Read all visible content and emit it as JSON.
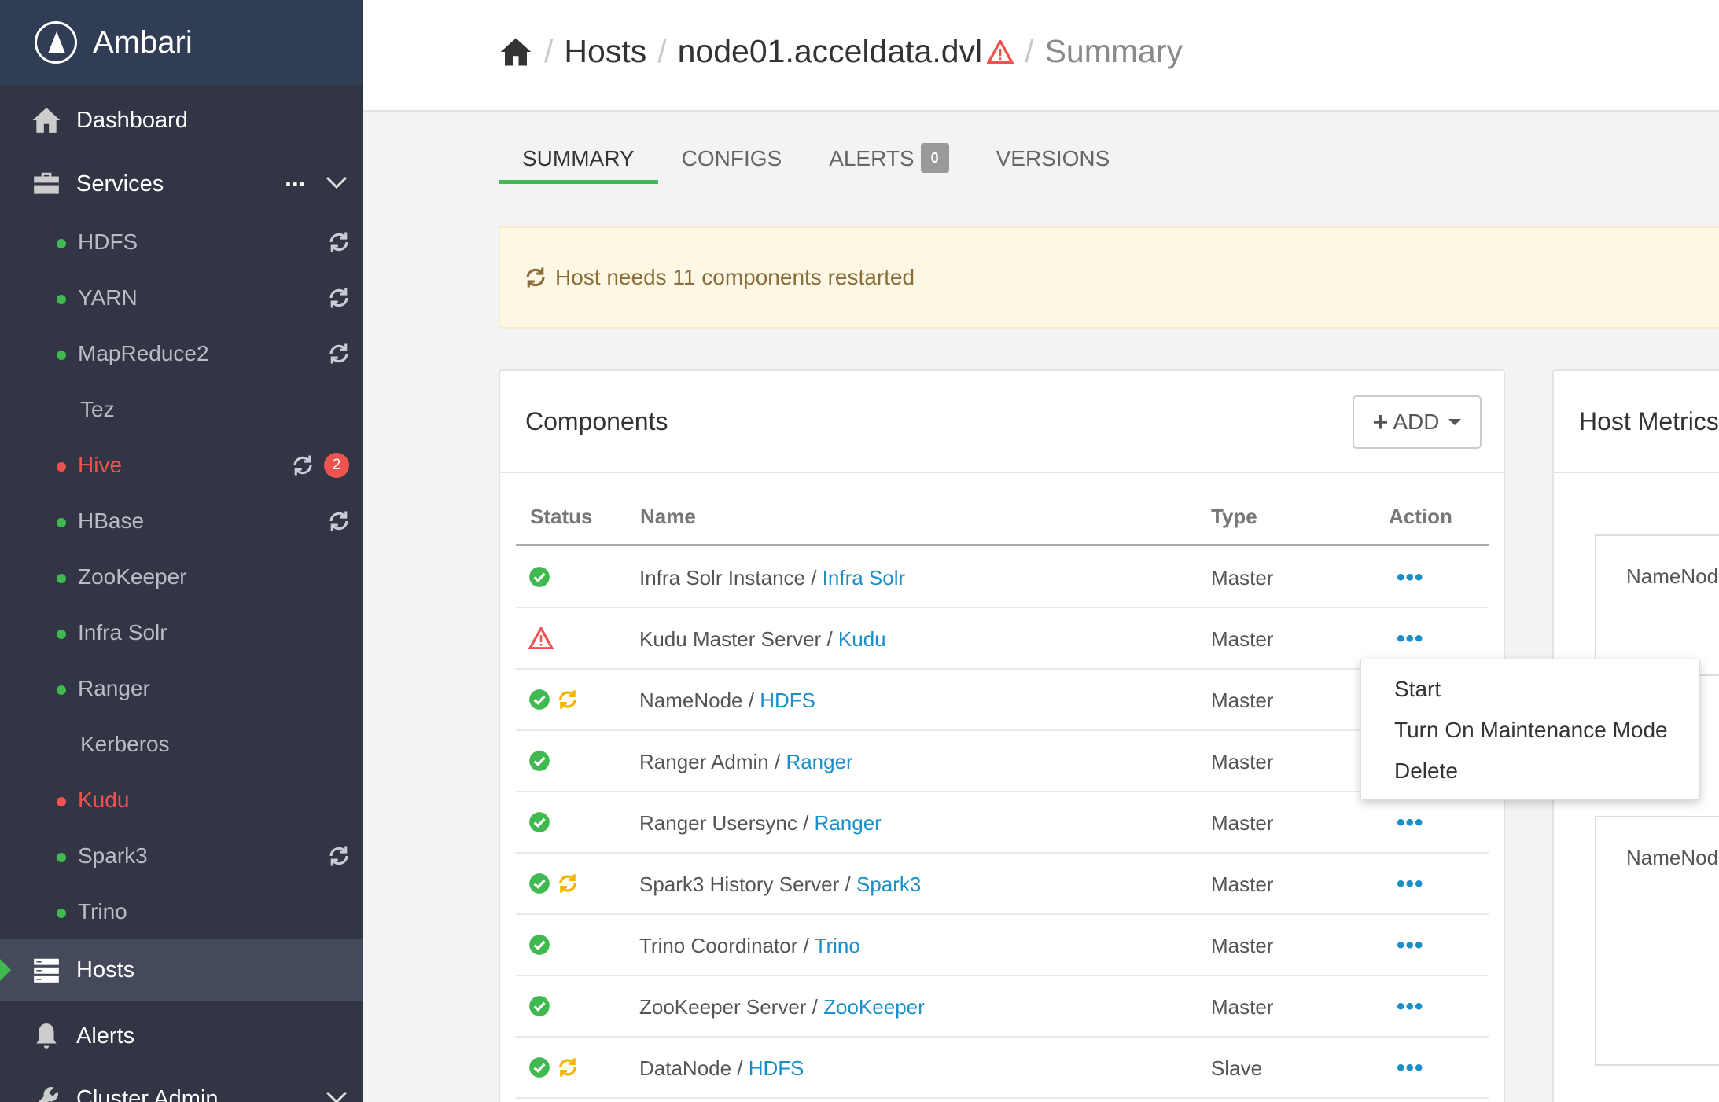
{
  "app": {
    "name": "Ambari"
  },
  "sidebar": {
    "dashboard": "Dashboard",
    "services": "Services",
    "services_more": "...",
    "service_items": [
      {
        "label": "HDFS",
        "status": "green",
        "restart": true
      },
      {
        "label": "YARN",
        "status": "green",
        "restart": true
      },
      {
        "label": "MapReduce2",
        "status": "green",
        "restart": true
      },
      {
        "label": "Tez",
        "status": "none",
        "restart": false
      },
      {
        "label": "Hive",
        "status": "red",
        "restart": true,
        "badge": "2"
      },
      {
        "label": "HBase",
        "status": "green",
        "restart": true
      },
      {
        "label": "ZooKeeper",
        "status": "green",
        "restart": false
      },
      {
        "label": "Infra Solr",
        "status": "green",
        "restart": false
      },
      {
        "label": "Ranger",
        "status": "green",
        "restart": false
      },
      {
        "label": "Kerberos",
        "status": "none",
        "restart": false
      },
      {
        "label": "Kudu",
        "status": "red",
        "restart": false
      },
      {
        "label": "Spark3",
        "status": "green",
        "restart": true
      },
      {
        "label": "Trino",
        "status": "green",
        "restart": false
      }
    ],
    "hosts": "Hosts",
    "alerts": "Alerts",
    "cluster_admin": "Cluster Admin"
  },
  "breadcrumb": {
    "sep": "/",
    "hosts": "Hosts",
    "host": "node01.acceldata.dvl",
    "current": "Summary"
  },
  "tabs": {
    "summary": "SUMMARY",
    "configs": "CONFIGS",
    "alerts": "ALERTS",
    "alerts_count": "0",
    "versions": "VERSIONS"
  },
  "alert": {
    "text": "Host needs 11 components restarted"
  },
  "components": {
    "title": "Components",
    "add_label": "ADD",
    "headers": {
      "status": "Status",
      "name": "Name",
      "type": "Type",
      "action": "Action"
    },
    "rows": [
      {
        "component": "Infra Solr Instance",
        "service": "Infra Solr",
        "type": "Master",
        "status": "ok",
        "restart": false
      },
      {
        "component": "Kudu Master Server",
        "service": "Kudu",
        "type": "Master",
        "status": "warn",
        "restart": false
      },
      {
        "component": "NameNode",
        "service": "HDFS",
        "type": "Master",
        "status": "ok",
        "restart": true
      },
      {
        "component": "Ranger Admin",
        "service": "Ranger",
        "type": "Master",
        "status": "ok",
        "restart": false
      },
      {
        "component": "Ranger Usersync",
        "service": "Ranger",
        "type": "Master",
        "status": "ok",
        "restart": false
      },
      {
        "component": "Spark3 History Server",
        "service": "Spark3",
        "type": "Master",
        "status": "ok",
        "restart": true
      },
      {
        "component": "Trino Coordinator",
        "service": "Trino",
        "type": "Master",
        "status": "ok",
        "restart": false
      },
      {
        "component": "ZooKeeper Server",
        "service": "ZooKeeper",
        "type": "Master",
        "status": "ok",
        "restart": false
      },
      {
        "component": "DataNode",
        "service": "HDFS",
        "type": "Slave",
        "status": "ok",
        "restart": true
      }
    ],
    "action_label": "•••"
  },
  "action_menu": {
    "items": [
      "Start",
      "Turn On Maintenance Mode",
      "Delete"
    ]
  },
  "host_metrics": {
    "title": "Host Metrics",
    "box1": "NameNode",
    "box2": "NameNode"
  },
  "colors": {
    "sidebar_bg": "#323544",
    "brand_bg": "#313d54",
    "accent_green": "#3fb950",
    "error_red": "#ef5350",
    "link_blue": "#1a8fc9",
    "restart_orange": "#f5b400"
  }
}
